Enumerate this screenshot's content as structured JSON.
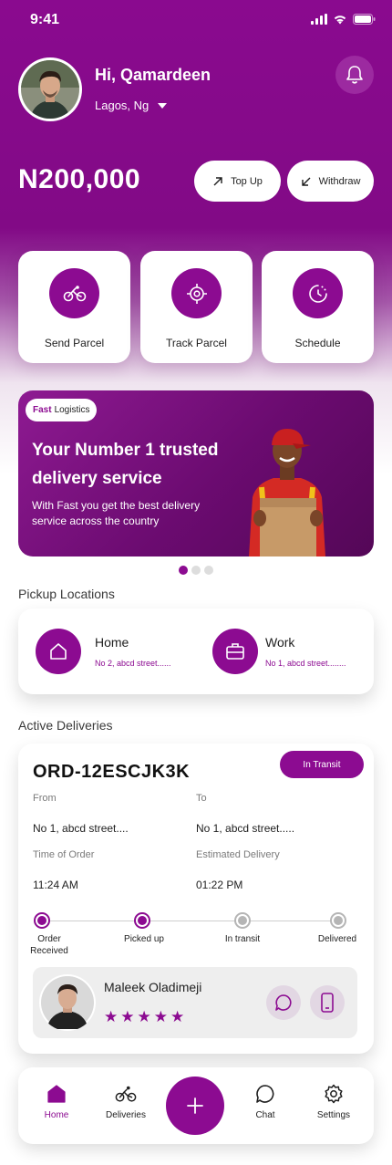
{
  "status_bar": {
    "time": "9:41"
  },
  "header": {
    "greeting": "Hi, Qamardeen",
    "location": "Lagos, Ng"
  },
  "wallet": {
    "balance": "N200,000",
    "topup_label": "Top Up",
    "withdraw_label": "Withdraw"
  },
  "quick_actions": [
    {
      "label": "Send Parcel",
      "icon": "bicycle-icon"
    },
    {
      "label": "Track Parcel",
      "icon": "target-icon"
    },
    {
      "label": "Schedule",
      "icon": "clock-icon"
    }
  ],
  "banner": {
    "tag_brand": "Fast",
    "tag_rest": "Logistics",
    "title": "Your Number 1 trusted delivery service",
    "text": "With Fast you get the best delivery service across the country",
    "slide_index": 1,
    "slide_count": 3
  },
  "pickup": {
    "title": "Pickup Locations",
    "locations": [
      {
        "name": "Home",
        "address": "No 2, abcd street......",
        "icon": "home-icon"
      },
      {
        "name": "Work",
        "address": "No 1, abcd street........",
        "icon": "briefcase-icon"
      }
    ]
  },
  "deliveries": {
    "title": "Active Deliveries",
    "order_id": "ORD-12ESCJK3K",
    "status": "In Transit",
    "from_label": "From",
    "from_value": "No 1, abcd street....",
    "to_label": "To",
    "to_value": "No 1, abcd street.....",
    "time_label": "Time of Order",
    "time_value": "11:24 AM",
    "eta_label": "Estimated Delivery",
    "eta_value": "01:22 PM",
    "steps": [
      {
        "label": "Order Received",
        "done": true
      },
      {
        "label": "Picked up",
        "done": true
      },
      {
        "label": "In transit",
        "done": false
      },
      {
        "label": "Delivered",
        "done": false
      }
    ],
    "driver": {
      "name": "Maleek Oladimeji",
      "rating": 5
    }
  },
  "nav": {
    "items": [
      {
        "label": "Home",
        "icon": "home-icon"
      },
      {
        "label": "Deliveries",
        "icon": "bicycle-icon"
      },
      {
        "label": "Chat",
        "icon": "chat-icon"
      },
      {
        "label": "Settings",
        "icon": "gear-icon"
      }
    ],
    "active": "Home"
  },
  "colors": {
    "brand": "#8c0b91",
    "accent_light": "#e2d7e3"
  }
}
